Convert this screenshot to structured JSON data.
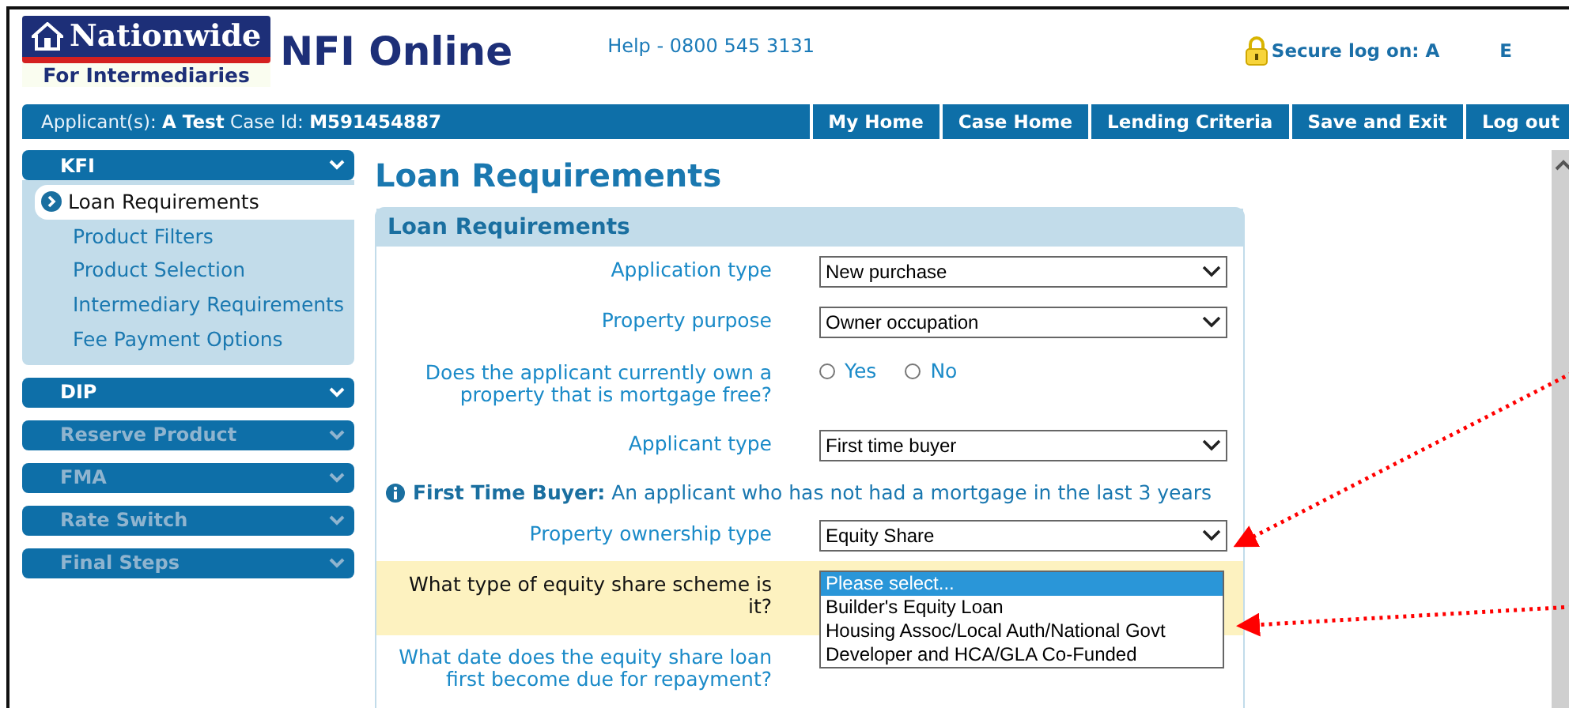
{
  "header": {
    "logo_title": "Nationwide",
    "logo_subtitle": "For Intermediaries",
    "product": "NFI Online",
    "help": "Help - 0800 545 3131",
    "secure_label": "Secure log on: A",
    "secure_user": "E"
  },
  "case_bar": {
    "applicant_label": "Applicant(s):",
    "applicant": "A Test",
    "case_label": "Case Id:",
    "case_id": "M591454887"
  },
  "nav": [
    "My Home",
    "Case Home",
    "Lending Criteria",
    "Save and Exit",
    "Log out"
  ],
  "sidebar": [
    {
      "label": "KFI",
      "disabled": false,
      "expanded": true,
      "items": [
        {
          "label": "Loan Requirements",
          "selected": true
        },
        {
          "label": "Product Filters",
          "selected": false
        },
        {
          "label": "Product Selection",
          "selected": false
        },
        {
          "label": "Intermediary Requirements",
          "selected": false
        },
        {
          "label": "Fee Payment Options",
          "selected": false
        }
      ]
    },
    {
      "label": "DIP",
      "disabled": false,
      "expanded": false
    },
    {
      "label": "Reserve Product",
      "disabled": true,
      "expanded": false
    },
    {
      "label": "FMA",
      "disabled": true,
      "expanded": false
    },
    {
      "label": "Rate Switch",
      "disabled": true,
      "expanded": false
    },
    {
      "label": "Final Steps",
      "disabled": true,
      "expanded": false
    }
  ],
  "page_title": "Loan Requirements",
  "panel": {
    "title": "Loan Requirements",
    "rows": [
      {
        "kind": "select",
        "label": "Application type",
        "value": "New purchase",
        "highlighted": false
      },
      {
        "kind": "select",
        "label": "Property purpose",
        "value": "Owner occupation",
        "highlighted": false
      },
      {
        "kind": "radio",
        "label": "Does the applicant currently own a property that is mortgage free?",
        "options": [
          {
            "label": "Yes",
            "selected": false
          },
          {
            "label": "No",
            "selected": false
          }
        ],
        "highlighted": false
      },
      {
        "kind": "select",
        "label": "Applicant type",
        "value": "First time buyer",
        "highlighted": false
      },
      {
        "kind": "info",
        "title": "First Time Buyer:",
        "text": "An applicant who has not had a mortgage in the last 3 years"
      },
      {
        "kind": "select",
        "label": "Property ownership type",
        "value": "Equity Share",
        "highlighted": false
      },
      {
        "kind": "listbox",
        "label": "What type of equity share scheme is it?",
        "options": [
          {
            "label": "Please select...",
            "selected": true
          },
          {
            "label": "Builder's Equity Loan",
            "selected": false
          },
          {
            "label": "Housing Assoc/Local Auth/National Govt",
            "selected": false
          },
          {
            "label": "Developer and HCA/GLA Co-Funded",
            "selected": false
          }
        ],
        "highlighted": true
      },
      {
        "kind": "question",
        "label": "What date does the equity share loan first become due for repayment?",
        "highlighted": false
      }
    ]
  }
}
